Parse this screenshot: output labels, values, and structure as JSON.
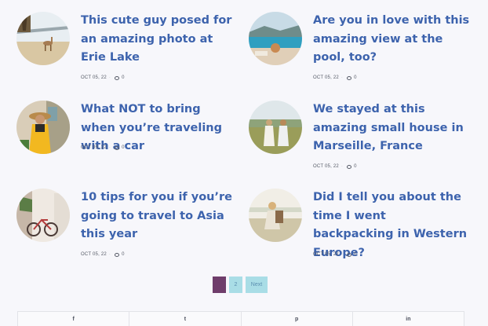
{
  "posts": [
    {
      "title": "This cute guy posed for an amazing photo at Erie Lake",
      "date": "OCT 05, 22",
      "comments": "0",
      "thumb": "deer-lake-photo"
    },
    {
      "title": "Are you in love with this amazing view at the pool, too?",
      "date": "OCT 05, 22",
      "comments": "0",
      "thumb": "pool-view-photo"
    },
    {
      "title": "What NOT to bring when you’re traveling with a car",
      "date": "OCT 05, 22",
      "comments": "0",
      "thumb": "woman-hat-photo"
    },
    {
      "title": "We stayed at this amazing small house in Marseille, France",
      "date": "OCT 05, 22",
      "comments": "0",
      "thumb": "two-women-field-photo"
    },
    {
      "title": "10 tips for you if you’re going to travel to Asia this year",
      "date": "OCT 05, 22",
      "comments": "0",
      "thumb": "bicycle-house-photo"
    },
    {
      "title": "Did I tell you about the time I went backpacking in Western Europe?",
      "date": "OCT 05, 22",
      "comments": "0",
      "thumb": "backpacker-photo"
    }
  ],
  "pagination": {
    "current": "1",
    "page2": "2",
    "next": "Next"
  },
  "share": [
    {
      "icon": "facebook-icon",
      "glyph": "f"
    },
    {
      "icon": "twitter-icon",
      "glyph": "t"
    },
    {
      "icon": "pinterest-icon",
      "glyph": "p"
    },
    {
      "icon": "linkedin-icon",
      "glyph": "in"
    }
  ],
  "colors": {
    "title": "#3d63ad",
    "page_current": "#6f3d6b",
    "page_other": "#a9dde6"
  }
}
